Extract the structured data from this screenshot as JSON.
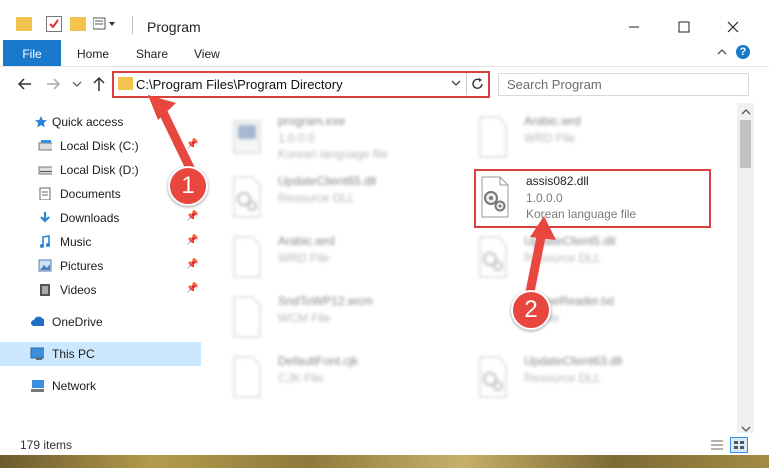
{
  "window": {
    "title": "Program"
  },
  "ribbon": {
    "tabs": [
      "File",
      "Home",
      "Share",
      "View"
    ]
  },
  "address": {
    "path": "C:\\Program Files\\Program Directory"
  },
  "search": {
    "placeholder": "Search Program"
  },
  "nav": {
    "items": [
      {
        "label": "Quick access",
        "icon": "star-icon"
      },
      {
        "label": "Local Disk (C:)",
        "icon": "drive-icon"
      },
      {
        "label": "Local Disk (D:)",
        "icon": "drive-icon"
      },
      {
        "label": "Documents",
        "icon": "documents-icon"
      },
      {
        "label": "Downloads",
        "icon": "download-icon"
      },
      {
        "label": "Music",
        "icon": "music-icon"
      },
      {
        "label": "Pictures",
        "icon": "pictures-icon"
      },
      {
        "label": "Videos",
        "icon": "videos-icon"
      },
      {
        "label": "OneDrive",
        "icon": "cloud-icon"
      },
      {
        "label": "This PC",
        "icon": "computer-icon"
      },
      {
        "label": "Network",
        "icon": "network-icon"
      }
    ]
  },
  "files": [
    {
      "name": "program.exe",
      "line2": "1.0.0.0",
      "line3": "Korean language file"
    },
    {
      "name": "Arabic.wrd",
      "line2": "WRD File",
      "line3": ""
    },
    {
      "name": "UpdateClient65.dll",
      "line2": "Resource DLL",
      "line3": ""
    },
    {
      "name": "assis082.dll",
      "line2": "1.0.0.0",
      "line3": "Korean language file"
    },
    {
      "name": "Arabic.wrd",
      "line2": "WRD File",
      "line3": ""
    },
    {
      "name": "UpdateClient5.dll",
      "line2": "Resource DLL",
      "line3": ""
    },
    {
      "name": "SndToWP12.wcm",
      "line2": "WCM File",
      "line3": ""
    },
    {
      "name": "fineReader.txt",
      "line2": "File",
      "line3": ""
    },
    {
      "name": "DefaultFont.cjk",
      "line2": "CJK File",
      "line3": ""
    },
    {
      "name": "UpdateClient63.dll",
      "line2": "Resource DLL",
      "line3": ""
    }
  ],
  "status": {
    "items": "179 items"
  },
  "callouts": {
    "one": "1",
    "two": "2"
  },
  "colors": {
    "accent": "#1979ca",
    "highlight": "#d9413f",
    "callout": "#e8473f"
  }
}
